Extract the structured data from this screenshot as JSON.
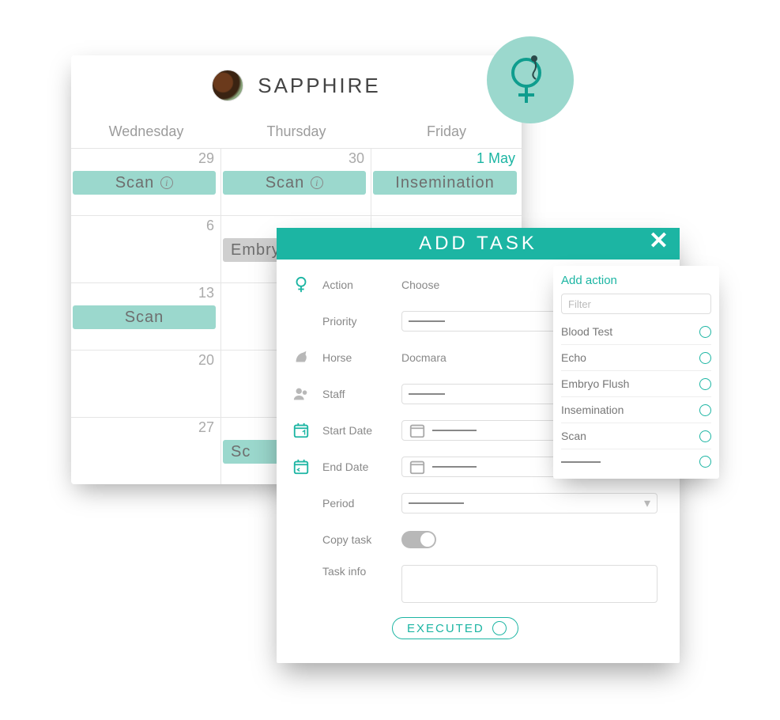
{
  "horse_name": "SAPPHIRE",
  "calendar": {
    "dow": [
      "Wednesday",
      "Thursday",
      "Friday"
    ],
    "weeks": [
      {
        "days": [
          {
            "num": "29",
            "pill": "Scan",
            "info": true
          },
          {
            "num": "30",
            "pill": "Scan",
            "info": true
          },
          {
            "num": "1 May",
            "first": true,
            "pill": "Insemination"
          }
        ]
      },
      {
        "days": [
          {
            "num": "6"
          },
          {
            "num": "",
            "pill": "Embry",
            "grey": true,
            "clip": true
          },
          {
            "num": ""
          }
        ]
      },
      {
        "days": [
          {
            "num": "13",
            "pill": "Scan"
          },
          {
            "num": ""
          },
          {
            "num": ""
          }
        ]
      },
      {
        "days": [
          {
            "num": "20"
          },
          {
            "num": ""
          },
          {
            "num": ""
          }
        ]
      },
      {
        "days": [
          {
            "num": "27"
          },
          {
            "num": "",
            "pill": "Sc",
            "clip": true
          },
          {
            "num": ""
          }
        ]
      }
    ]
  },
  "modal": {
    "title": "ADD TASK",
    "fields": {
      "action_label": "Action",
      "action_value": "Choose",
      "priority_label": "Priority",
      "horse_label": "Horse",
      "horse_value": "Docmara",
      "staff_label": "Staff",
      "start_label": "Start Date",
      "end_label": "End Date",
      "period_label": "Period",
      "copy_label": "Copy task",
      "info_label": "Task info",
      "executed_label": "EXECUTED"
    }
  },
  "popover": {
    "title": "Add action",
    "filter_placeholder": "Filter",
    "options": [
      "Blood Test",
      "Echo",
      "Embryo Flush",
      "Insemination",
      "Scan"
    ]
  }
}
